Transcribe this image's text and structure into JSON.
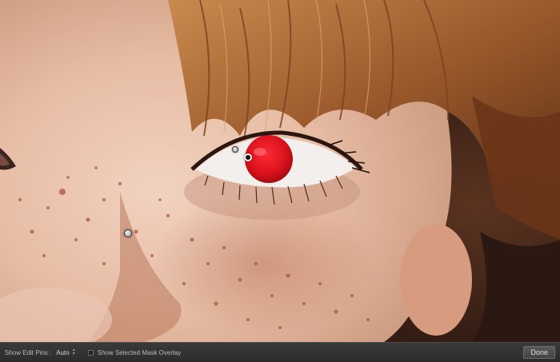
{
  "photo": {
    "subject": "close-up-face-photo",
    "mask_color": "#d8111c"
  },
  "toolbar": {
    "show_edit_pins_label": "Show Edit Pins :",
    "show_edit_pins_value": "Auto",
    "mask_overlay_label": "Show Selected Mask Overlay",
    "mask_overlay_checked": false,
    "done_label": "Done"
  },
  "colors": {
    "toolbar_bg": "#2c2c2c",
    "pupil_mask": "#d8111c"
  }
}
